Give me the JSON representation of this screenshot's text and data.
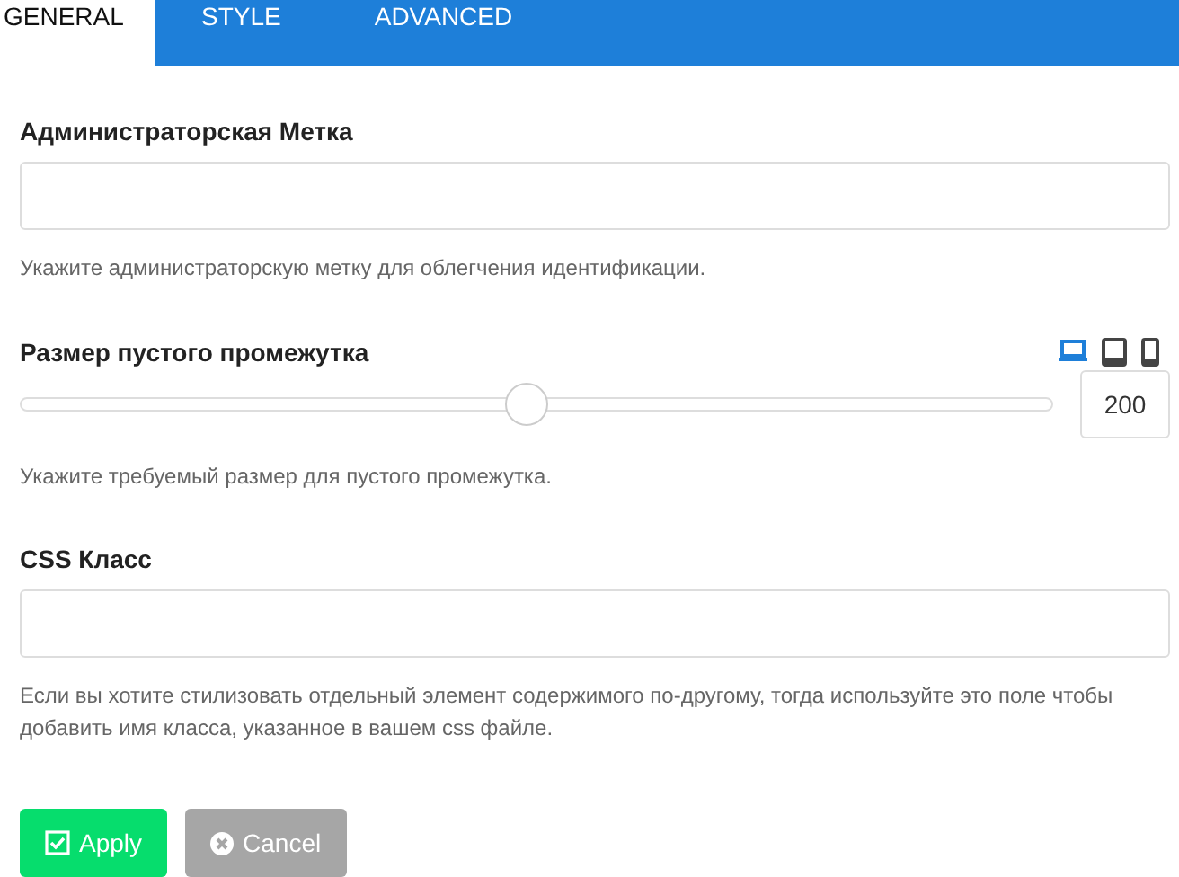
{
  "tabs": [
    {
      "label": "GENERAL",
      "selected": true
    },
    {
      "label": "STYLE",
      "selected": false
    },
    {
      "label": "ADVANCED",
      "selected": false
    }
  ],
  "admin_label": {
    "label": "Администраторская Метка",
    "hint": "Укажите администраторскую метку для облегчения идентификации."
  },
  "spacer_size": {
    "label": "Размер пустого промежутка",
    "devices": [
      {
        "kind": "desktop",
        "selected": true
      },
      {
        "kind": "tablet",
        "selected": false
      },
      {
        "kind": "phone",
        "selected": false
      }
    ],
    "level": 0.49,
    "value": "200",
    "hint": "Укажите требуемый размер для пустого промежутка."
  },
  "css_class": {
    "label": "CSS Класс",
    "hint": "Если вы хотите стилизовать отдельный элемент содержимого по-другому, тогда используйте это поле чтобы добавить имя класса, указанное в вашем css файле."
  },
  "buttons": [
    {
      "label": "Apply",
      "kind": "apply"
    },
    {
      "label": "Cancel",
      "kind": "cancel"
    }
  ]
}
